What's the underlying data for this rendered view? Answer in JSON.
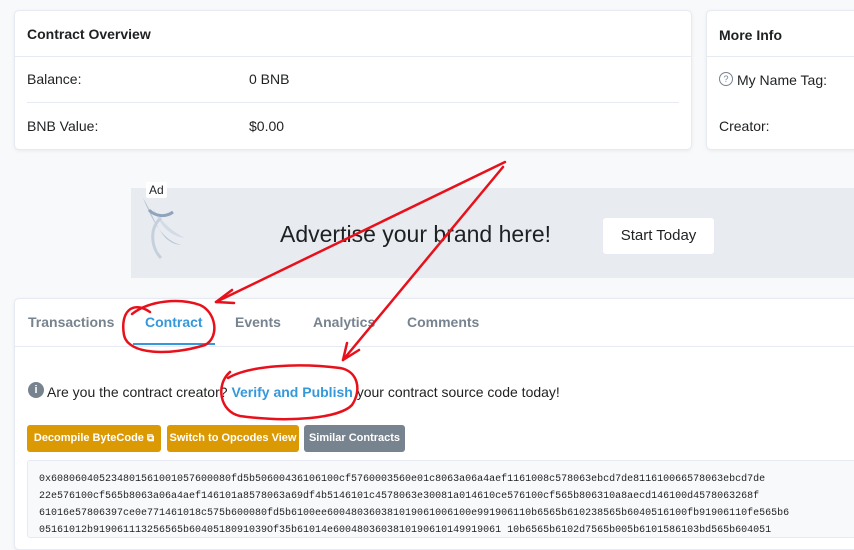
{
  "overview": {
    "title": "Contract Overview",
    "rows": [
      {
        "label": "Balance:",
        "value": "0 BNB"
      },
      {
        "label": "BNB Value:",
        "value": "$0.00"
      }
    ]
  },
  "more_info": {
    "title": "More Info",
    "name_tag_label": "My Name Tag:",
    "creator_label": "Creator:"
  },
  "ad": {
    "badge": "Ad",
    "headline": "Advertise your brand here!",
    "cta": "Start Today"
  },
  "tabs": [
    {
      "label": "Transactions"
    },
    {
      "label": "Contract",
      "active": true
    },
    {
      "label": "Events"
    },
    {
      "label": "Analytics"
    },
    {
      "label": "Comments"
    }
  ],
  "notice": {
    "prefix": "Are you the contract creator?",
    "link": "Verify and Publish",
    "suffix": "your contract source code today!"
  },
  "buttons": {
    "decompile": "Decompile ByteCode",
    "opcodes": "Switch to Opcodes View",
    "similar": "Similar Contracts"
  },
  "bytecode": [
    "0x608060405234801561001057600080fd5b50600436106100cf5760003560e01c8063a06a4aef1161008c578063ebcd7de811610066578063ebcd7de",
    "22e576100cf565b8063a06a4aef146101a8578063a69df4b5146101c4578063e30081a014610ce576100cf565b806310a8aecd146100d4578063268f",
    "61016e57806397ce0e771461018c575b600080fd5b6100ee600480360381019061006100e991906110b6565b610238565b6040516100fb91906110fe565b6",
    "05161012b919061113256565b6040518091039Of35b61014e6004803603810190610149919061 10b6565b6102d7565b005b6101586103bd565b604051"
  ],
  "colors": {
    "accent": "#3498db",
    "warning_button": "#db9a04",
    "secondary_button": "#77838f",
    "annotation": "#e8101a"
  }
}
